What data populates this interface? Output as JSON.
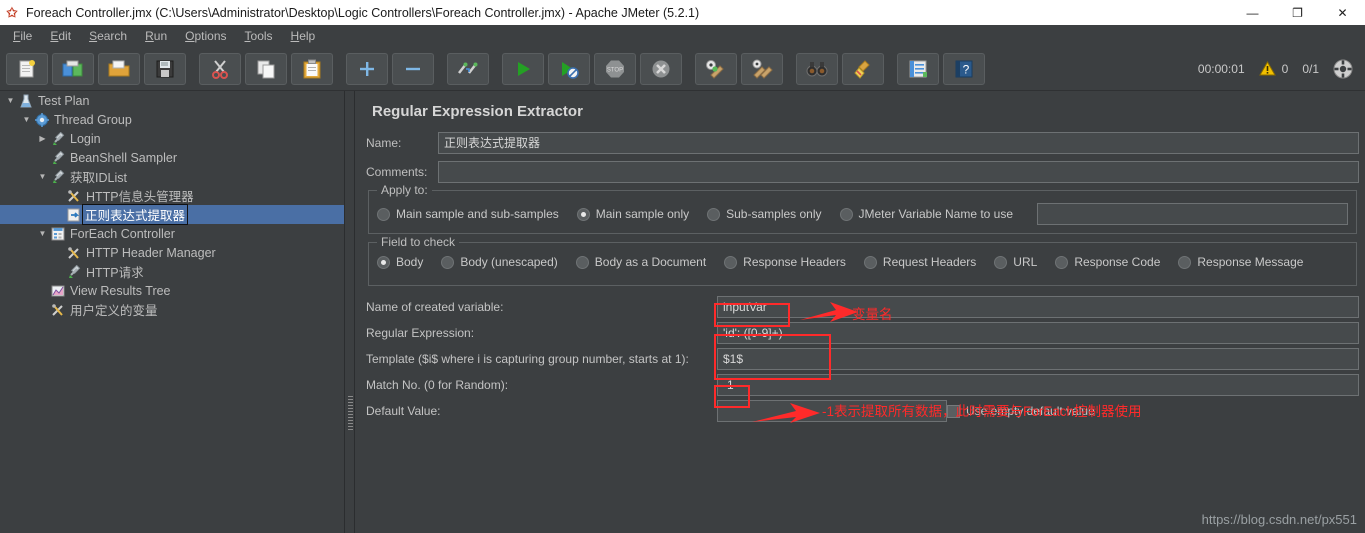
{
  "window": {
    "title": "Foreach Controller.jmx (C:\\Users\\Administrator\\Desktop\\Logic Controllers\\Foreach Controller.jmx) - Apache JMeter (5.2.1)",
    "app_icon": "jmeter-feather-icon",
    "minimize": "—",
    "maximize": "❐",
    "close": "✕"
  },
  "menubar": {
    "items": [
      {
        "mnemonic": "F",
        "rest": "ile",
        "name": "menu-file"
      },
      {
        "mnemonic": "E",
        "rest": "dit",
        "name": "menu-edit"
      },
      {
        "mnemonic": "S",
        "rest": "earch",
        "name": "menu-search"
      },
      {
        "mnemonic": "R",
        "rest": "un",
        "name": "menu-run"
      },
      {
        "mnemonic": "O",
        "rest": "ptions",
        "name": "menu-options"
      },
      {
        "mnemonic": "T",
        "rest": "ools",
        "name": "menu-tools"
      },
      {
        "mnemonic": "H",
        "rest": "elp",
        "name": "menu-help"
      }
    ]
  },
  "toolbar": {
    "buttons": [
      {
        "icon": "new-document-icon",
        "sep": false
      },
      {
        "icon": "templates-icon",
        "sep": false
      },
      {
        "icon": "open-folder-icon",
        "sep": false
      },
      {
        "icon": "save-floppy-icon",
        "sep": true
      },
      {
        "icon": "cut-scissors-icon",
        "sep": false
      },
      {
        "icon": "copy-icon",
        "sep": false
      },
      {
        "icon": "paste-clipboard-icon",
        "sep": true
      },
      {
        "icon": "expand-plus-icon",
        "sep": false
      },
      {
        "icon": "collapse-minus-icon",
        "sep": true
      },
      {
        "icon": "toggle-icon",
        "sep": true
      },
      {
        "icon": "start-play-icon",
        "sep": false
      },
      {
        "icon": "start-no-pauses-icon",
        "sep": false
      },
      {
        "icon": "stop-icon",
        "sep": false
      },
      {
        "icon": "shutdown-icon",
        "sep": true
      },
      {
        "icon": "clear-icon",
        "sep": false
      },
      {
        "icon": "clear-all-icon",
        "sep": true
      },
      {
        "icon": "search-binoculars-icon",
        "sep": false
      },
      {
        "icon": "reset-search-broom-icon",
        "sep": true
      },
      {
        "icon": "function-helper-icon",
        "sep": false
      },
      {
        "icon": "help-book-icon",
        "sep": false
      }
    ],
    "elapsed_time": "00:00:01",
    "warning_icon": "warning-triangle-icon",
    "warning_count": "0",
    "threads": "0/1",
    "connect_icon": "remote-connect-icon"
  },
  "tree": {
    "items": [
      {
        "label": "Test Plan",
        "depth": 0,
        "twisty": "▼",
        "icon": "test-plan-icon",
        "selected": false,
        "name": "tree-item-test-plan"
      },
      {
        "label": "Thread Group",
        "depth": 1,
        "twisty": "▼",
        "icon": "thread-group-gear-icon",
        "selected": false,
        "name": "tree-item-thread-group"
      },
      {
        "label": "Login",
        "depth": 2,
        "twisty": "▶",
        "icon": "http-sampler-icon",
        "selected": false,
        "name": "tree-item-login"
      },
      {
        "label": "BeanShell Sampler",
        "depth": 2,
        "twisty": "",
        "icon": "http-sampler-icon",
        "selected": false,
        "name": "tree-item-beanshell-sampler"
      },
      {
        "label": "获取IDList",
        "depth": 2,
        "twisty": "▼",
        "icon": "http-sampler-icon",
        "selected": false,
        "name": "tree-item-get-idlist"
      },
      {
        "label": "HTTP信息头管理器",
        "depth": 3,
        "twisty": "",
        "icon": "config-element-icon",
        "selected": false,
        "name": "tree-item-http-header-manager-cn"
      },
      {
        "label": "正则表达式提取器",
        "depth": 3,
        "twisty": "",
        "icon": "post-processor-icon",
        "selected": true,
        "name": "tree-item-regex-extractor"
      },
      {
        "label": "ForEach Controller",
        "depth": 2,
        "twisty": "▼",
        "icon": "controller-icon",
        "selected": false,
        "name": "tree-item-foreach-controller"
      },
      {
        "label": "HTTP Header Manager",
        "depth": 3,
        "twisty": "",
        "icon": "config-element-icon",
        "selected": false,
        "name": "tree-item-http-header-manager"
      },
      {
        "label": "HTTP请求",
        "depth": 3,
        "twisty": "",
        "icon": "http-sampler-icon",
        "selected": false,
        "name": "tree-item-http-request"
      },
      {
        "label": "View Results Tree",
        "depth": 2,
        "twisty": "",
        "icon": "listener-icon",
        "selected": false,
        "name": "tree-item-view-results-tree"
      },
      {
        "label": "用户定义的变量",
        "depth": 2,
        "twisty": "",
        "icon": "config-element-icon",
        "selected": false,
        "name": "tree-item-user-defined-variables"
      }
    ]
  },
  "main": {
    "panel_title": "Regular Expression Extractor",
    "name_label": "Name:",
    "name_value": "正则表达式提取器",
    "comments_label": "Comments:",
    "comments_value": "",
    "apply_to": {
      "title": "Apply to:",
      "options": [
        {
          "label": "Main sample and sub-samples",
          "checked": false,
          "name": "radio-main-and-sub"
        },
        {
          "label": "Main sample only",
          "checked": true,
          "name": "radio-main-only"
        },
        {
          "label": "Sub-samples only",
          "checked": false,
          "name": "radio-sub-only"
        },
        {
          "label": "JMeter Variable Name to use",
          "checked": false,
          "name": "radio-jmeter-variable"
        }
      ],
      "variable_value": ""
    },
    "field_to_check": {
      "title": "Field to check",
      "options": [
        {
          "label": "Body",
          "checked": true,
          "name": "radio-body"
        },
        {
          "label": "Body (unescaped)",
          "checked": false,
          "name": "radio-body-unescaped"
        },
        {
          "label": "Body as a Document",
          "checked": false,
          "name": "radio-body-document"
        },
        {
          "label": "Response Headers",
          "checked": false,
          "name": "radio-response-headers"
        },
        {
          "label": "Request Headers",
          "checked": false,
          "name": "radio-request-headers"
        },
        {
          "label": "URL",
          "checked": false,
          "name": "radio-url"
        },
        {
          "label": "Response Code",
          "checked": false,
          "name": "radio-response-code"
        },
        {
          "label": "Response Message",
          "checked": false,
          "name": "radio-response-message"
        }
      ]
    },
    "fields": {
      "var_name_label": "Name of created variable:",
      "var_name_value": "inputVar",
      "regex_label": "Regular Expression:",
      "regex_value": "'id': ([0-9]+)",
      "template_label": "Template ($i$ where i is capturing group number, starts at 1):",
      "template_value": "$1$",
      "match_no_label": "Match No. (0 for Random):",
      "match_no_value": "-1",
      "default_value_label": "Default Value:",
      "default_value_value": "",
      "use_empty_label": "Use empty default value",
      "use_empty_checked": false
    }
  },
  "annotations": {
    "variable_name_note": "变量名",
    "match_no_note": "-1表示提取所有数据，此时需要与ForEach控制器使用",
    "color": "#ff2a2a"
  },
  "watermark": "https://blog.csdn.net/px551"
}
